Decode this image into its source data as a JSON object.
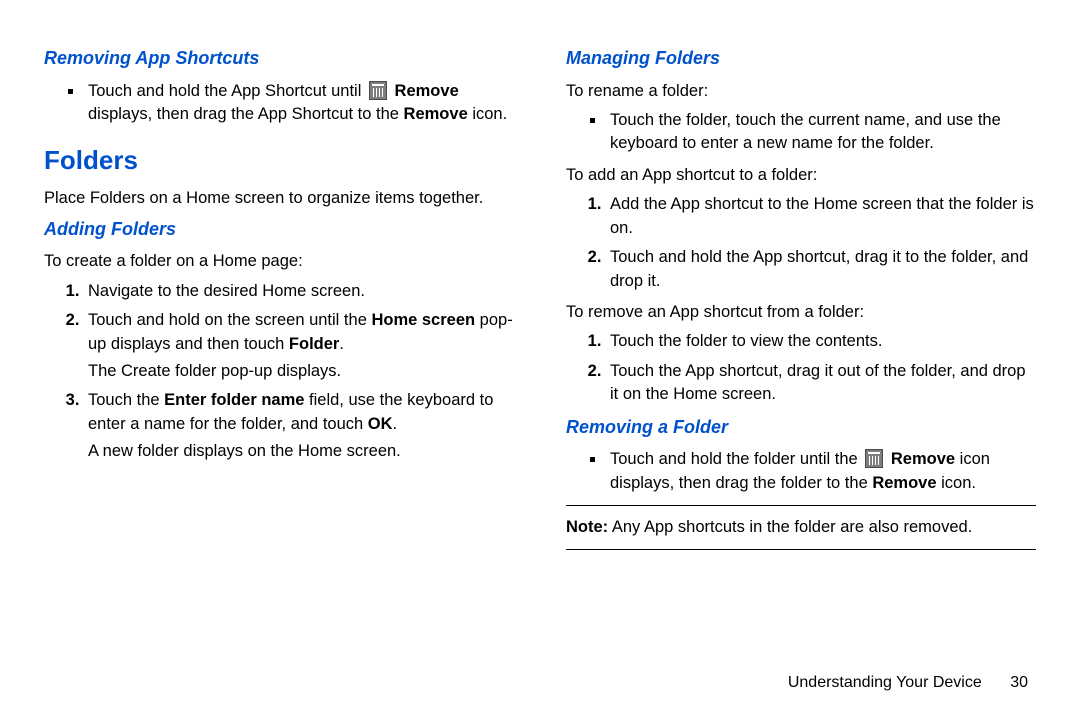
{
  "left": {
    "removing_app_title": "Removing App Shortcuts",
    "removing_app_bullet_pre": "Touch and hold the App Shortcut until ",
    "removing_app_bullet_remove": "Remove",
    "removing_app_bullet_post1": " displays, then drag the App Shortcut to the ",
    "removing_app_bullet_remove2": "Remove",
    "removing_app_bullet_post2": " icon.",
    "folders_h2": "Folders",
    "folders_intro": "Place Folders on a Home screen to organize items together.",
    "adding_title": "Adding Folders",
    "adding_intro": "To create a folder on a Home page:",
    "adding_1": "Navigate to the desired Home screen.",
    "adding_2_pre": "Touch and hold on the screen until the ",
    "adding_2_homescreen": "Home screen",
    "adding_2_mid": " pop-up displays and then touch ",
    "adding_2_folder": "Folder",
    "adding_2_post": ".",
    "adding_2_cont": "The Create folder pop-up displays.",
    "adding_3_pre": "Touch the ",
    "adding_3_enter": "Enter folder name",
    "adding_3_mid": " field, use the keyboard to enter a name for the folder, and touch ",
    "adding_3_ok": "OK",
    "adding_3_post": ".",
    "adding_3_cont": "A new folder displays on the Home screen."
  },
  "right": {
    "managing_title": "Managing Folders",
    "rename_intro": "To rename a folder:",
    "rename_bullet": "Touch the folder, touch the current name, and use the keyboard to enter a new name for the folder.",
    "addshortcut_intro": "To add an App shortcut to a folder:",
    "addshortcut_1": "Add the App shortcut to the Home screen that the folder is on.",
    "addshortcut_2": "Touch and hold the App shortcut, drag it to the folder, and drop it.",
    "removeshortcut_intro": "To remove an App shortcut from a folder:",
    "removeshortcut_1": "Touch the folder to view the contents.",
    "removeshortcut_2": "Touch the App shortcut, drag it out of the folder, and drop it on the Home screen.",
    "removing_folder_title": "Removing a Folder",
    "removing_folder_pre": "Touch and hold the folder until the ",
    "removing_folder_remove1": "Remove",
    "removing_folder_mid": " icon displays, then drag the folder to the ",
    "removing_folder_remove2": "Remove",
    "removing_folder_post": " icon.",
    "note_label": "Note:",
    "note_text": " Any App shortcuts in the folder are also removed."
  },
  "footer": {
    "section": "Understanding Your Device",
    "page": "30"
  }
}
